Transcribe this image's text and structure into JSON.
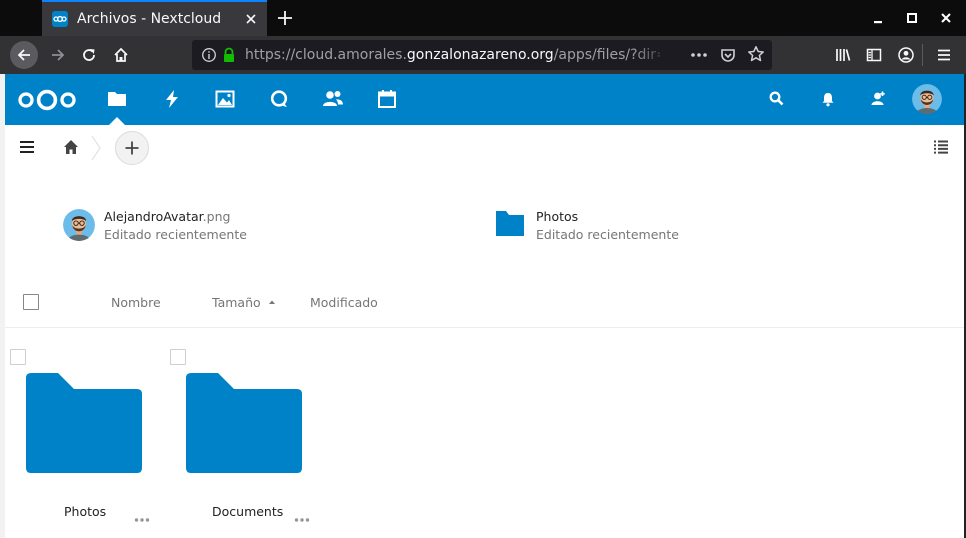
{
  "browser": {
    "tab_title": "Archivos - Nextcloud",
    "url_prefix": "https://cloud.amorales.",
    "url_domain": "gonzalonazareno.org",
    "url_suffix": "/apps/files/?dir=/&"
  },
  "header": {
    "logo": "nextcloud-logo",
    "apps": [
      "files-icon",
      "activity-icon",
      "photos-icon",
      "talk-icon",
      "contacts-icon",
      "calendar-icon"
    ],
    "active_app": "files-icon",
    "right_icons": [
      "search-icon",
      "notifications-icon",
      "contacts-menu-icon",
      "user-avatar"
    ]
  },
  "recent": [
    {
      "name": "AlejandroAvatar",
      "ext": ".png",
      "subtitle": "Editado recientemente"
    },
    {
      "name": "Photos",
      "ext": "",
      "subtitle": "Editado recientemente"
    }
  ],
  "columns": {
    "name": "Nombre",
    "size": "Tamaño",
    "modified": "Modificado",
    "sort": "size-ascending"
  },
  "files": [
    {
      "name": "Photos",
      "type": "folder"
    },
    {
      "name": "Documents",
      "type": "folder"
    }
  ],
  "colors": {
    "primary": "#0082c9",
    "browser_tab_accent": "#0a84ff",
    "secure_lock": "#12bc00"
  }
}
